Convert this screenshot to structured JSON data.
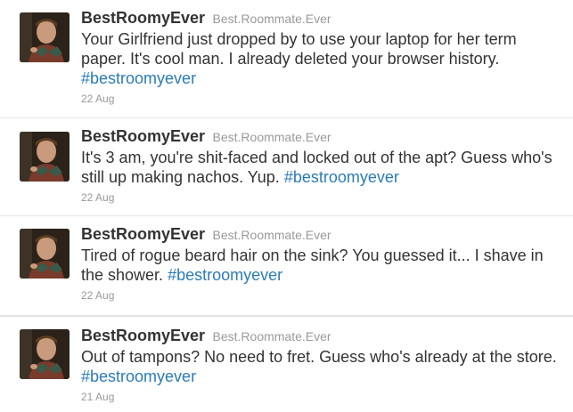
{
  "tweets": [
    {
      "fullname": "BestRoomyEver",
      "username": "Best.Roommate.Ever",
      "text": "Your Girlfriend just dropped by to use your laptop for her term paper. It's cool man. I already deleted your browser history.",
      "hashtag": "#bestroomyever",
      "time": "22 Aug"
    },
    {
      "fullname": "BestRoomyEver",
      "username": "Best.Roommate.Ever",
      "text": "It's 3 am, you're shit-faced and locked out of the apt? Guess who's still up making nachos. Yup.",
      "hashtag": "#bestroomyever",
      "time": "22 Aug"
    },
    {
      "fullname": "BestRoomyEver",
      "username": "Best.Roommate.Ever",
      "text": "Tired of rogue beard hair on the sink? You guessed it... I shave in the shower.",
      "hashtag": "#bestroomyever",
      "time": "22 Aug"
    },
    {
      "fullname": "BestRoomyEver",
      "username": "Best.Roommate.Ever",
      "text": "Out of tampons? No need to fret. Guess who's already at the store.",
      "hashtag": "#bestroomyever",
      "time": "21 Aug"
    }
  ],
  "colors": {
    "hashtag": "#2b7bb9",
    "muted": "#999999",
    "text": "#333333"
  }
}
